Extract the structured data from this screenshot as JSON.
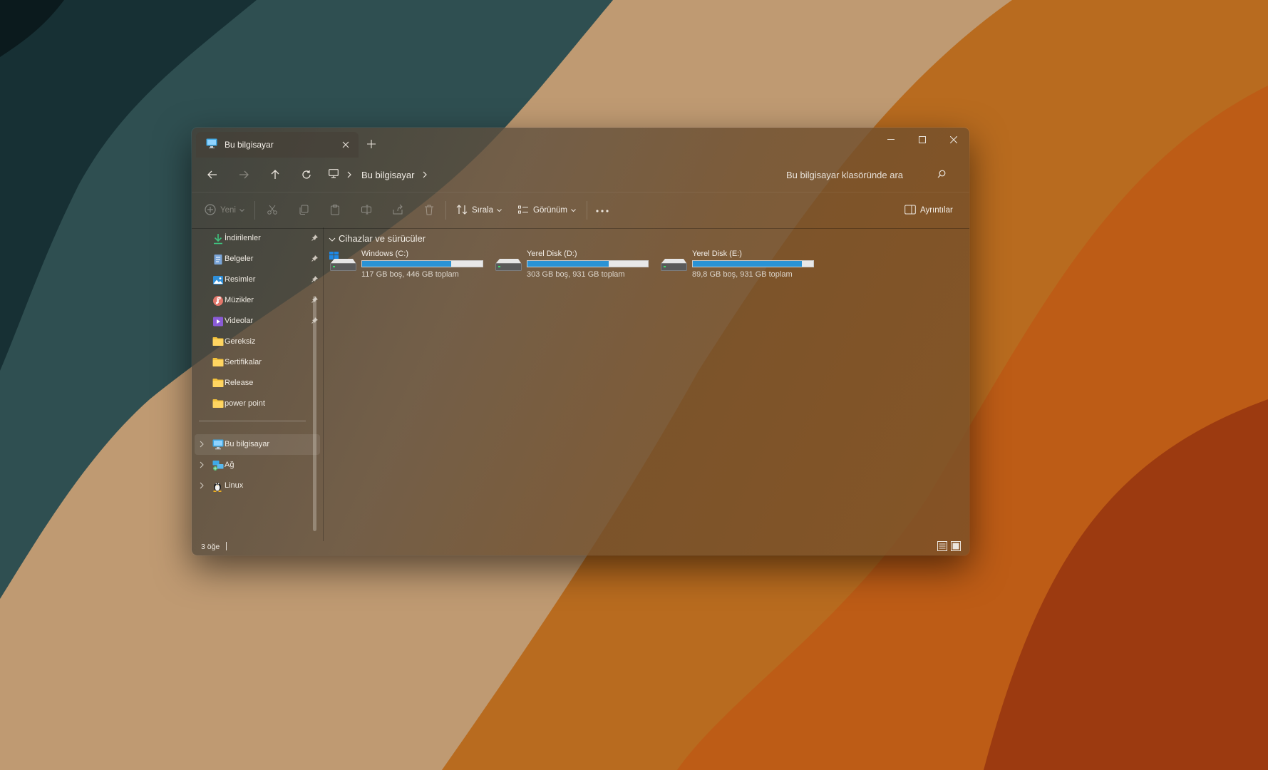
{
  "window": {
    "tab_title": "Bu bilgisayar"
  },
  "address": {
    "crumb": "Bu bilgisayar",
    "search_placeholder": "Bu bilgisayar klasöründe ara"
  },
  "toolbar": {
    "new_label": "Yeni",
    "sort_label": "Sırala",
    "view_label": "Görünüm",
    "details_label": "Ayrıntılar"
  },
  "sidebar": {
    "pinned": [
      {
        "label": "İndirilenler",
        "icon": "download-icon"
      },
      {
        "label": "Belgeler",
        "icon": "documents-icon"
      },
      {
        "label": "Resimler",
        "icon": "pictures-icon"
      },
      {
        "label": "Müzikler",
        "icon": "music-icon"
      },
      {
        "label": "Videolar",
        "icon": "videos-icon"
      }
    ],
    "folders": [
      "Gereksiz",
      "Sertifikalar",
      "Release",
      "power point"
    ],
    "locations": [
      {
        "label": "Bu bilgisayar",
        "icon": "computer-icon",
        "selected": true
      },
      {
        "label": "Ağ",
        "icon": "network-icon"
      },
      {
        "label": "Linux",
        "icon": "linux-icon"
      }
    ]
  },
  "content": {
    "group_title": "Cihazlar ve sürücüler",
    "drives": [
      {
        "name": "Windows (C:)",
        "info": "117 GB boş, 446 GB toplam",
        "used_fraction": 0.738,
        "os_drive": true
      },
      {
        "name": "Yerel Disk (D:)",
        "info": "303 GB boş, 931 GB toplam",
        "used_fraction": 0.675
      },
      {
        "name": "Yerel Disk (E:)",
        "info": "89,8 GB boş, 931 GB toplam",
        "used_fraction": 0.904
      }
    ]
  },
  "status": {
    "item_count": "3 öğe"
  },
  "colors": {
    "accent": "#2a93d5",
    "folder": "#f5c33b"
  }
}
